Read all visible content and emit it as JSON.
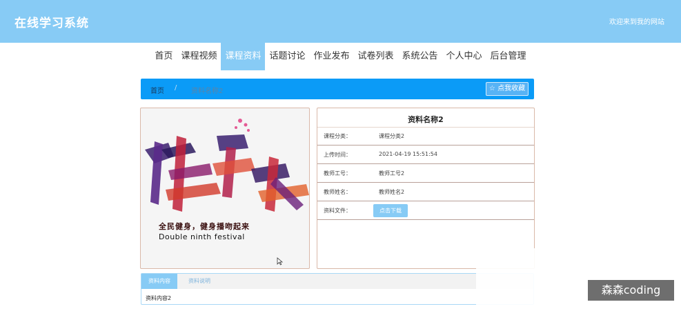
{
  "header": {
    "site_title": "在线学习系统",
    "welcome": "欢迎来到我的网站"
  },
  "nav": {
    "items": [
      {
        "label": "首页"
      },
      {
        "label": "课程视频"
      },
      {
        "label": "课程资料",
        "active": true
      },
      {
        "label": "话题讨论"
      },
      {
        "label": "作业发布"
      },
      {
        "label": "试卷列表"
      },
      {
        "label": "系统公告"
      },
      {
        "label": "个人中心"
      },
      {
        "label": "后台管理"
      }
    ]
  },
  "breadcrumb": {
    "home": "首页",
    "separator": "/",
    "current": "资料名称2",
    "favorite_label": "☆ 点我收藏"
  },
  "poster": {
    "tagline": "全民健身，健身播吻起来",
    "subtitle": "Double ninth festival"
  },
  "info": {
    "title": "资料名称2",
    "rows": [
      {
        "label": "课程分类：",
        "value": "课程分类2"
      },
      {
        "label": "上传时间：",
        "value": "2021-04-19 15:51:54"
      },
      {
        "label": "教师工号：",
        "value": "教师工号2"
      },
      {
        "label": "教师姓名：",
        "value": "教师姓名2"
      },
      {
        "label": "资料文件：",
        "button": "点击下载"
      }
    ]
  },
  "tabs": {
    "items": [
      {
        "label": "资料内容"
      },
      {
        "label": "资料说明"
      }
    ],
    "content": "资料内容2"
  },
  "watermark": "森森coding",
  "colors": {
    "header": "#87cbf5",
    "breadcrumb": "#0b9bf7",
    "border": "#d9b8a8"
  }
}
